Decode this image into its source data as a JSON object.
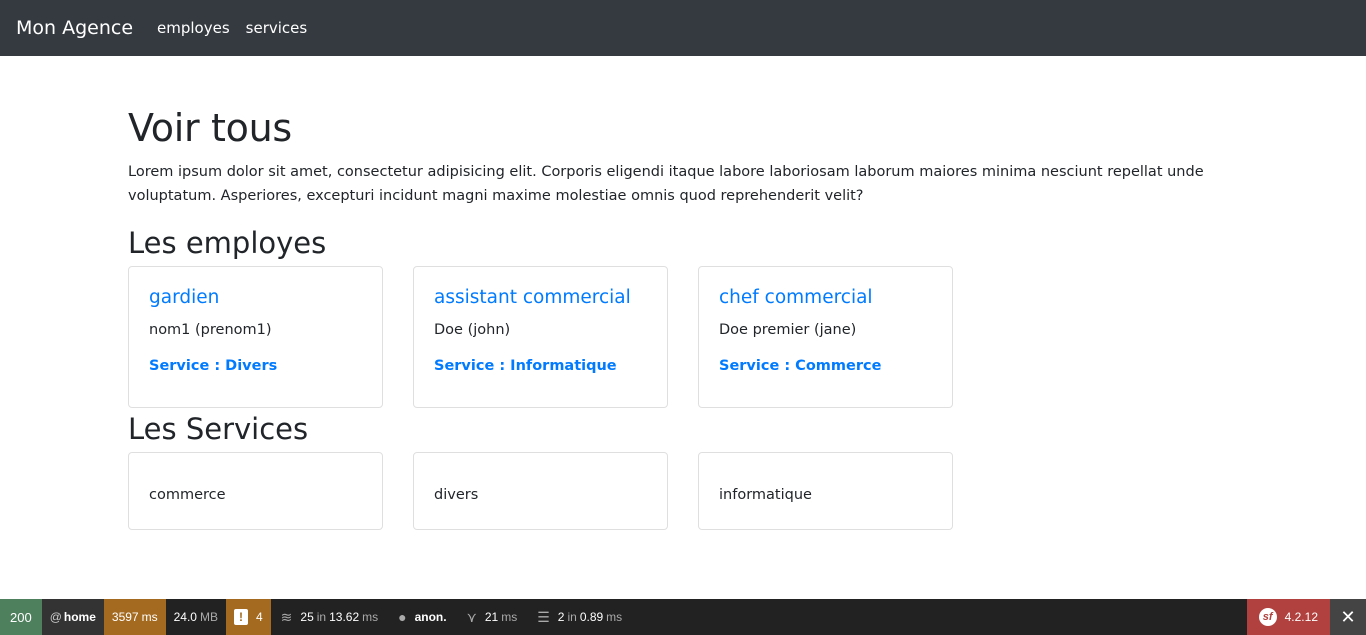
{
  "navbar": {
    "brand": "Mon Agence",
    "links": [
      "employes",
      "services"
    ]
  },
  "main": {
    "title": "Voir tous",
    "lead": "Lorem ipsum dolor sit amet, consectetur adipisicing elit. Corporis eligendi itaque labore laboriosam laborum maiores minima nesciunt repellat unde voluptatum. Asperiores, excepturi incidunt magni maxime molestiae omnis quod reprehenderit velit?",
    "employees_heading": "Les employes",
    "employees": [
      {
        "title": "gardien",
        "name": "nom1 (prenom1)",
        "service": "Service : Divers"
      },
      {
        "title": "assistant commercial",
        "name": "Doe (john)",
        "service": "Service : Informatique"
      },
      {
        "title": "chef commercial",
        "name": "Doe premier (jane)",
        "service": "Service : Commerce"
      }
    ],
    "services_heading": "Les Services",
    "services": [
      "commerce",
      "divers",
      "informatique"
    ]
  },
  "toolbar": {
    "status": "200",
    "route_prefix": "@",
    "route": "home",
    "time_value": "3597",
    "time_unit": "ms",
    "memory_value": "24.0",
    "memory_unit": "MB",
    "warnings": "4",
    "queries_count": "25",
    "queries_in": "in",
    "queries_time": "13.62",
    "queries_unit": "ms",
    "user": "anon.",
    "twig_value": "21",
    "twig_unit": "ms",
    "cache_count": "2",
    "cache_in": "in",
    "cache_time": "0.89",
    "cache_unit": "ms",
    "version": "4.2.12",
    "colors": {
      "status": "#4f805d",
      "warning": "#a46a1f",
      "version": "#b0413e"
    }
  }
}
